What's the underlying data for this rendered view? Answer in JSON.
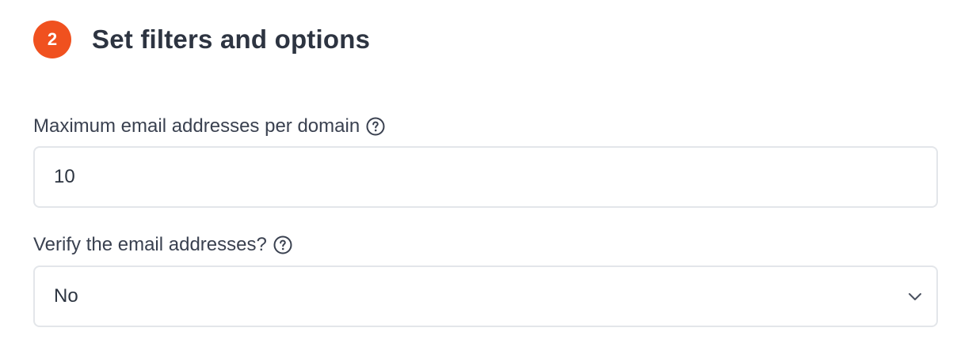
{
  "step": {
    "number": "2",
    "title": "Set filters and options",
    "badge_color": "#f0511f"
  },
  "fields": {
    "max_emails": {
      "label": "Maximum email addresses per domain",
      "value": "10",
      "help_icon": "question-circle-icon"
    },
    "verify": {
      "label": "Verify the email addresses?",
      "selected": "No",
      "help_icon": "question-circle-icon",
      "dropdown_icon": "chevron-down-icon"
    }
  }
}
